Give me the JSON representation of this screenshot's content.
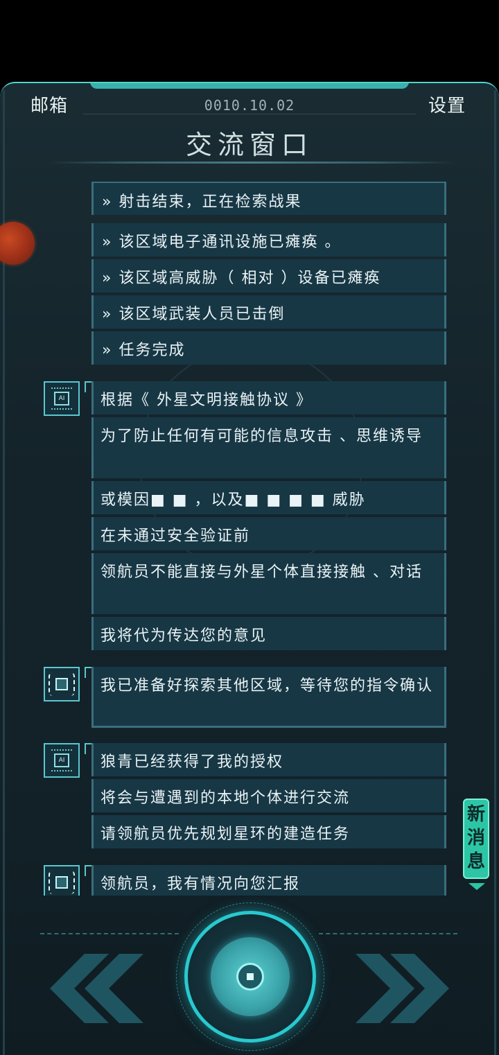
{
  "header": {
    "left": "邮箱",
    "right": "设置",
    "date": "0010.10.02",
    "title": "交流窗口"
  },
  "messages": {
    "sys1": "» 射击结束，正在检索战果",
    "sys2": "» 该区域电子通讯设施已瘫痪 。",
    "sys3": "» 该区域高威胁（ 相对 ）设备已瘫痪",
    "sys4": "» 该区域武装人员已击倒",
    "sys5": "» 任务完成",
    "ai1a": "根据《 外星文明接触协议 》",
    "ai1b": "为了防止任何有可能的信息攻击 、思维诱导",
    "ai1c": "或模因■ ■ ，以及■ ■ ■ ■ 威胁",
    "ai1d": "在未通过安全验证前",
    "ai1e": "领航员不能直接与外星个体直接接触 、对话",
    "ai1f": "我将代为传达您的意见",
    "bot1": "我已准备好探索其他区域，等待您的指令确认",
    "ai2a": "狼青已经获得了我的授权",
    "ai2b": "将会与遭遇到的本地个体进行交流",
    "ai2c": "请领航员优先规划星环的建造任务",
    "bot2": "领航员，我有情况向您汇报"
  },
  "avatar_chip_label": "AI",
  "new_message_badge": "新消息",
  "icons": [
    "ai-chip-icon",
    "bot-chip-icon",
    "double-chevron-left-icon",
    "double-chevron-right-icon",
    "center-dial-icon"
  ],
  "colors": {
    "accent": "#2cc6a6",
    "bubble": "#173745",
    "frame_top": "#4fd6cf"
  }
}
